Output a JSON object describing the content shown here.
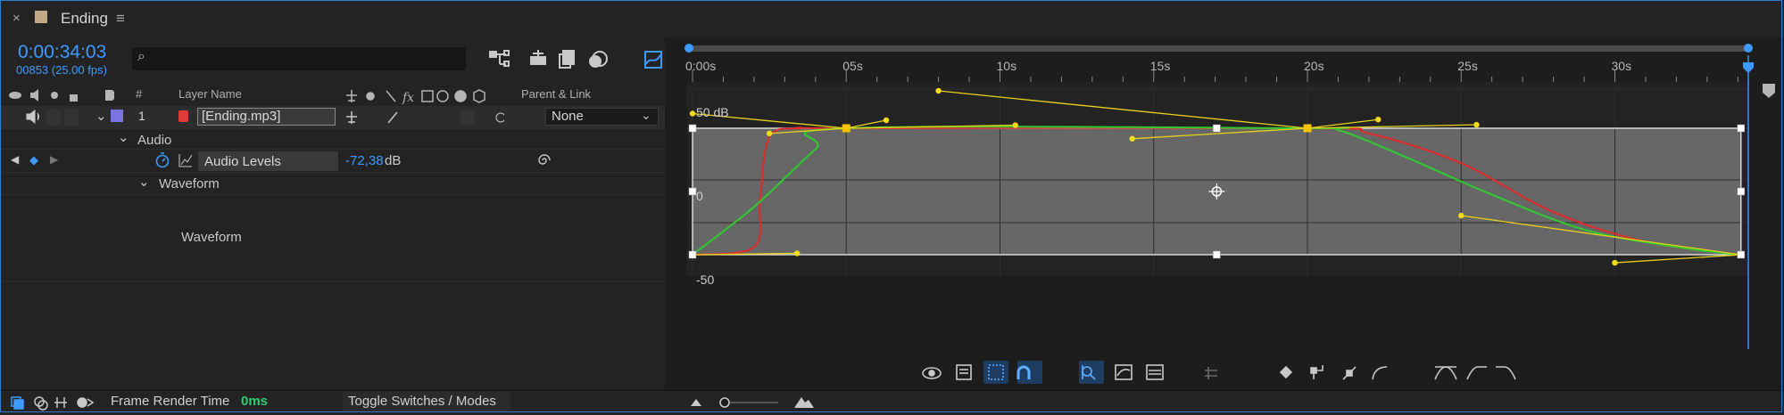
{
  "tab": {
    "title": "Ending",
    "close_glyph": "×",
    "menu_glyph": "≡",
    "swatch_color": "#bfa882"
  },
  "time": {
    "timecode": "0:00:34:03",
    "frame_info": "00853 (25.00 fps)"
  },
  "search": {
    "placeholder": ""
  },
  "columns": {
    "num": "#",
    "layer_name": "Layer Name",
    "parent_link": "Parent & Link"
  },
  "layer": {
    "number": "1",
    "name": "[Ending.mp3]",
    "parent": "None",
    "label_color": "#7b74e0"
  },
  "tree": {
    "audio": "Audio",
    "audio_levels": "Audio Levels",
    "audio_levels_value": "-72,38",
    "audio_levels_unit": "dB",
    "waveform_group": "Waveform",
    "waveform_item": "Waveform"
  },
  "status": {
    "frame_render_label": "Frame Render Time",
    "frame_render_value": "0ms",
    "toggle_label": "Toggle Switches / Modes"
  },
  "ruler": {
    "labels": [
      "0:00s",
      "05s",
      "10s",
      "15s",
      "20s",
      "25s",
      "30s"
    ]
  },
  "graph": {
    "y_labels": [
      "50 dB",
      "0",
      "-50"
    ],
    "accent_color": "#3d9bff",
    "work_area_color": "#2ecc2e"
  },
  "chart_data": {
    "type": "line",
    "xlabel": "",
    "ylabel": "",
    "x_unit": "s",
    "y_unit": "dB",
    "xlim": [
      0,
      34.1
    ],
    "ylim": [
      -72.38,
      50
    ],
    "grid": true,
    "series": [
      {
        "color": "#e02a2a",
        "points": [
          [
            0,
            -72.4
          ],
          [
            2,
            -68
          ],
          [
            2.2,
            -40
          ],
          [
            2.5,
            -5
          ],
          [
            3.5,
            0
          ],
          [
            5,
            0
          ],
          [
            20,
            0
          ],
          [
            22,
            -3
          ],
          [
            25,
            -20
          ],
          [
            28,
            -48
          ],
          [
            31,
            -65
          ],
          [
            34.1,
            -72.4
          ]
        ]
      },
      {
        "color": "#2ecc2e",
        "points": [
          [
            0,
            -72.4
          ],
          [
            2,
            -45
          ],
          [
            4,
            -12
          ],
          [
            5,
            0
          ],
          [
            20,
            0
          ],
          [
            21,
            -1
          ],
          [
            23,
            -15
          ],
          [
            26,
            -38
          ],
          [
            29,
            -58
          ],
          [
            32,
            -68
          ],
          [
            34.1,
            -72.4
          ]
        ]
      }
    ],
    "keyframes": [
      [
        5,
        0
      ],
      [
        20,
        0
      ]
    ]
  }
}
